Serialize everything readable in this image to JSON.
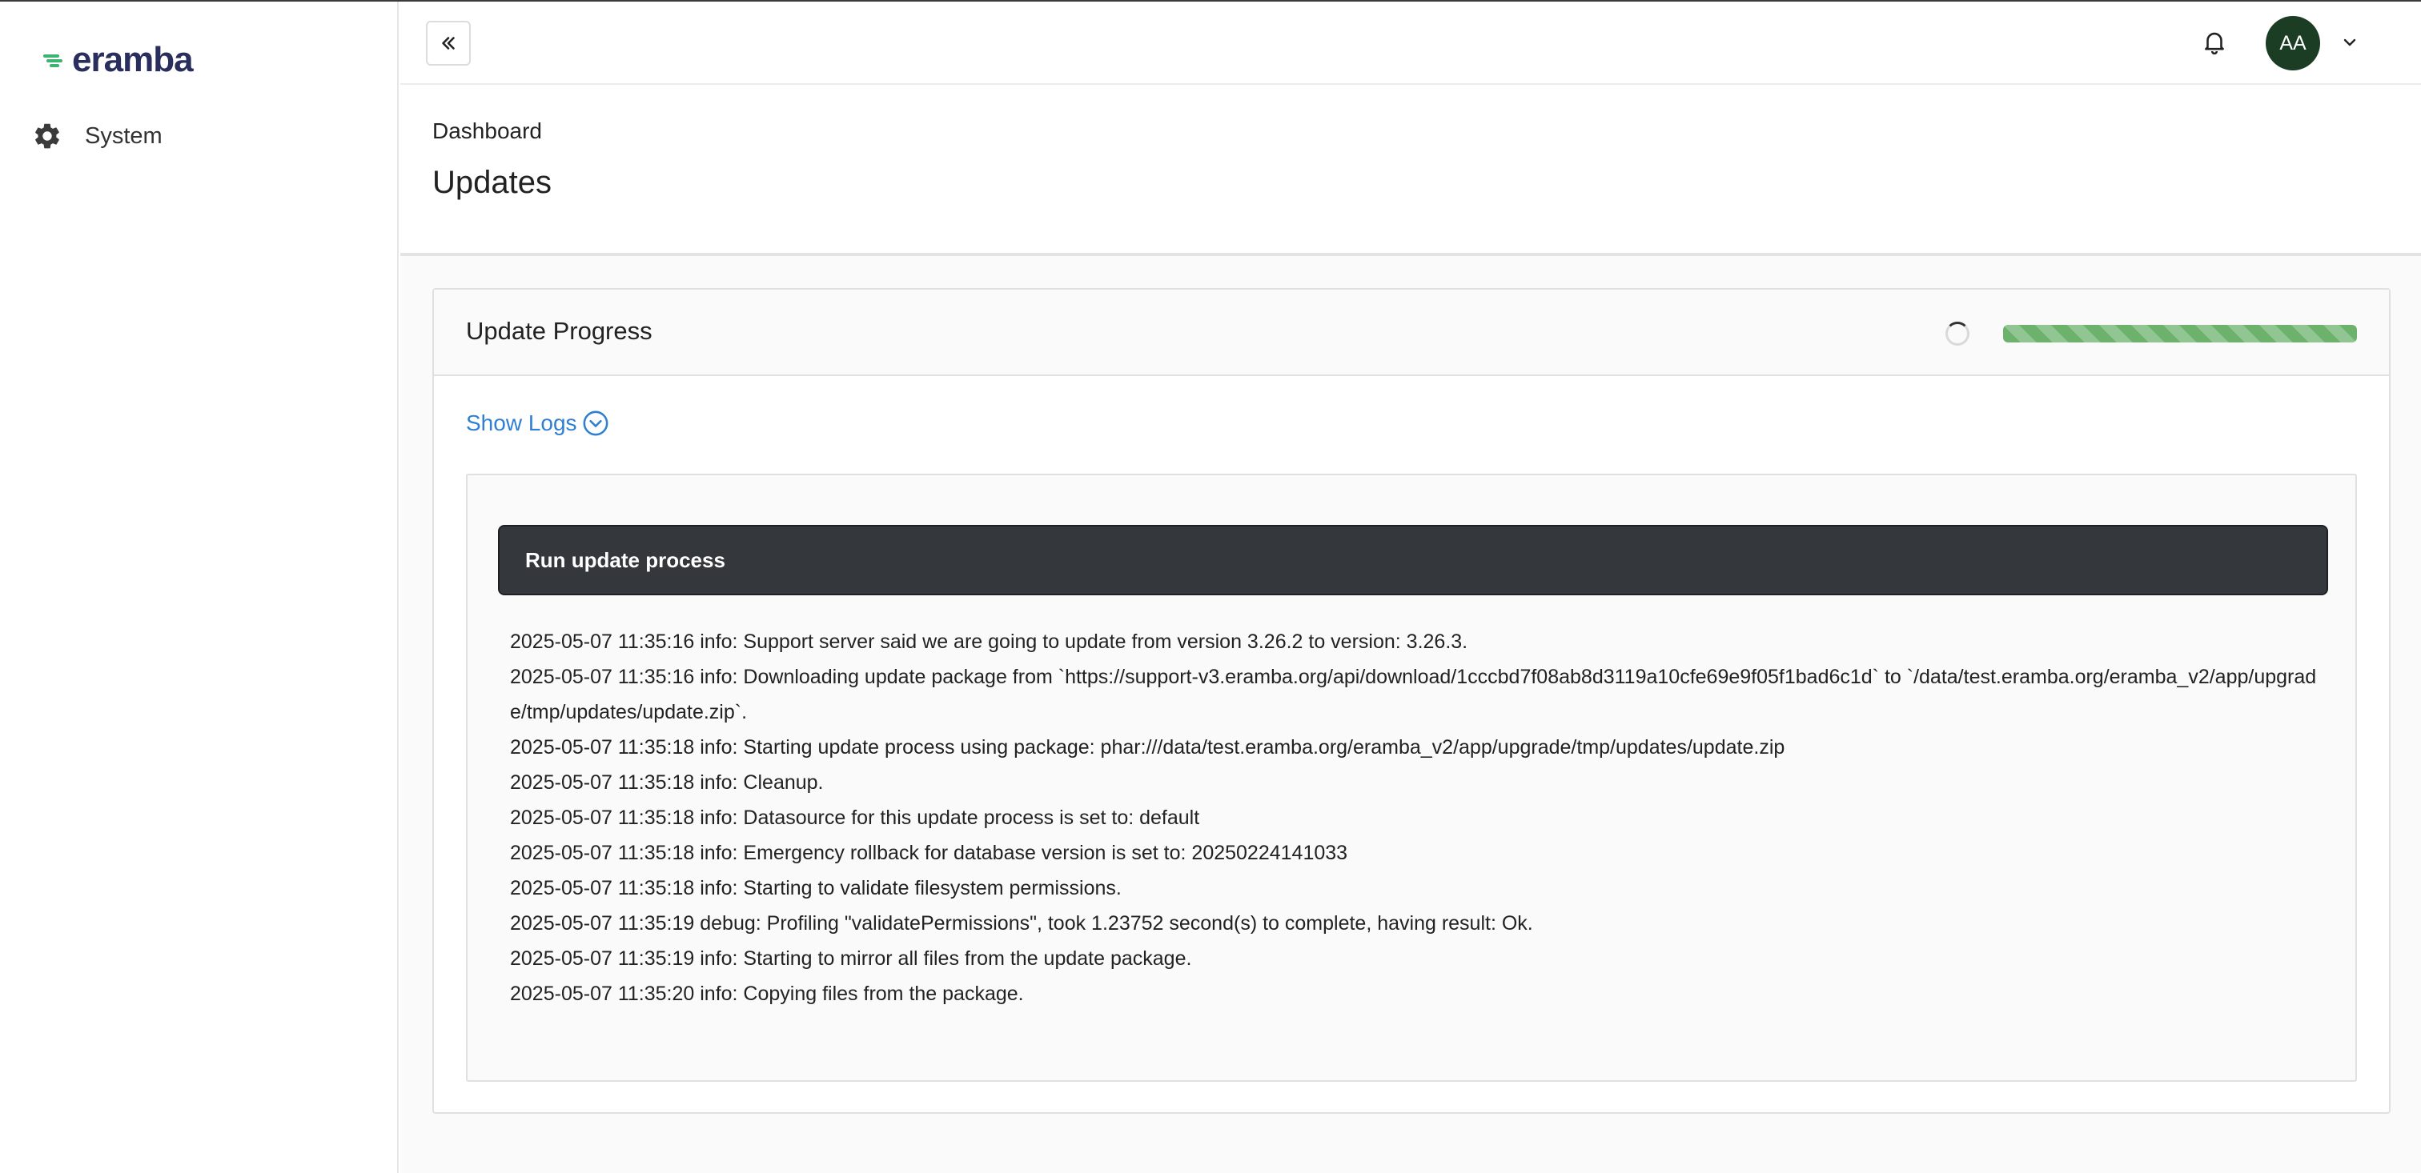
{
  "brand": {
    "name": "eramba"
  },
  "sidebar": {
    "items": [
      {
        "label": "System",
        "icon": "gear-icon"
      }
    ]
  },
  "topbar": {
    "avatar_initials": "AA",
    "avatar_color": "#1a3d24"
  },
  "header": {
    "breadcrumb": "Dashboard",
    "title": "Updates"
  },
  "card": {
    "title": "Update Progress",
    "progress_fraction": 1.0,
    "progress_color": "#6cb26c",
    "show_logs_label": "Show Logs",
    "run_title": "Run update process",
    "logs": [
      "2025-05-07 11:35:16 info: Support server said we are going to update from version 3.26.2 to version: 3.26.3.",
      "2025-05-07 11:35:16 info: Downloading update package from `https://support-v3.eramba.org/api/download/1cccbd7f08ab8d3119a10cfe69e9f05f1bad6c1d` to `/data/test.eramba.org/eramba_v2/app/upgrade/tmp/updates/update.zip`.",
      "2025-05-07 11:35:18 info: Starting update process using package: phar:///data/test.eramba.org/eramba_v2/app/upgrade/tmp/updates/update.zip",
      "2025-05-07 11:35:18 info: Cleanup.",
      "2025-05-07 11:35:18 info: Datasource for this update process is set to: default",
      "2025-05-07 11:35:18 info: Emergency rollback for database version is set to: 20250224141033",
      "2025-05-07 11:35:18 info: Starting to validate filesystem permissions.",
      "2025-05-07 11:35:19 debug: Profiling \"validatePermissions\", took 1.23752 second(s) to complete, having result: Ok.",
      "2025-05-07 11:35:19 info: Starting to mirror all files from the update package.",
      "2025-05-07 11:35:20 info: Copying files from the package."
    ]
  }
}
